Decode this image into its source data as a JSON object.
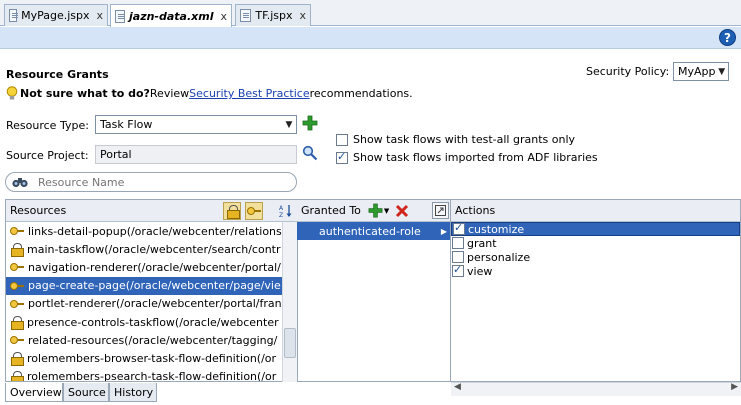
{
  "tabs": [
    {
      "label": "MyPage.jspx",
      "close": "x"
    },
    {
      "label": "jazn-data.xml",
      "close": "x"
    },
    {
      "label": "TF.jspx",
      "close": "x"
    }
  ],
  "help_label": "?",
  "heading": "Resource Grants",
  "tip": {
    "bold": "Not sure what to do?",
    "text": " Review ",
    "link": "Security Best Practice",
    "after": " recommendations."
  },
  "security_policy": {
    "label": "Security Policy:",
    "value": "MyApp"
  },
  "resource_type": {
    "label": "Resource Type:",
    "value": "Task Flow"
  },
  "source_project": {
    "label": "Source Project:",
    "value": "Portal"
  },
  "options": [
    {
      "label": "Show task flows with test-all grants only",
      "checked": false
    },
    {
      "label": "Show task flows imported from ADF libraries",
      "checked": true
    }
  ],
  "search": {
    "placeholder": "Resource Name"
  },
  "resources_panel": {
    "header": "Resources",
    "items": [
      {
        "icon": "key-icon",
        "text": "links-detail-popup(/oracle/webcenter/relations"
      },
      {
        "icon": "lock-icon",
        "text": "main-taskflow(/oracle/webcenter/search/contr"
      },
      {
        "icon": "key-icon",
        "text": "navigation-renderer(/oracle/webcenter/portal/"
      },
      {
        "icon": "key-icon",
        "text": "page-create-page(/oracle/webcenter/page/vie",
        "selected": true
      },
      {
        "icon": "key-icon",
        "text": "portlet-renderer(/oracle/webcenter/portal/fran"
      },
      {
        "icon": "lock-icon",
        "text": "presence-controls-taskflow(/oracle/webcenter"
      },
      {
        "icon": "key-icon",
        "text": "related-resources(/oracle/webcenter/tagging/"
      },
      {
        "icon": "lock-icon",
        "text": "rolemembers-browser-task-flow-definition(/or"
      },
      {
        "icon": "lock-icon",
        "text": "rolemembers-psearch-task-flow-definition(/or"
      }
    ]
  },
  "granted_panel": {
    "header": "Granted To",
    "rows": [
      "authenticated-role"
    ]
  },
  "actions_panel": {
    "header": "Actions",
    "rows": [
      {
        "label": "customize",
        "checked": true,
        "selected": true
      },
      {
        "label": "grant",
        "checked": false
      },
      {
        "label": "personalize",
        "checked": false
      },
      {
        "label": "view",
        "checked": true
      }
    ]
  },
  "bottom_tabs": [
    "Overview",
    "Source",
    "History"
  ],
  "colors": {
    "selection": "#2f64b9",
    "link": "#1a3fb0",
    "band": "#d5e4f7",
    "add_green": "#2c9a2c",
    "delete_red": "#d0241c"
  }
}
